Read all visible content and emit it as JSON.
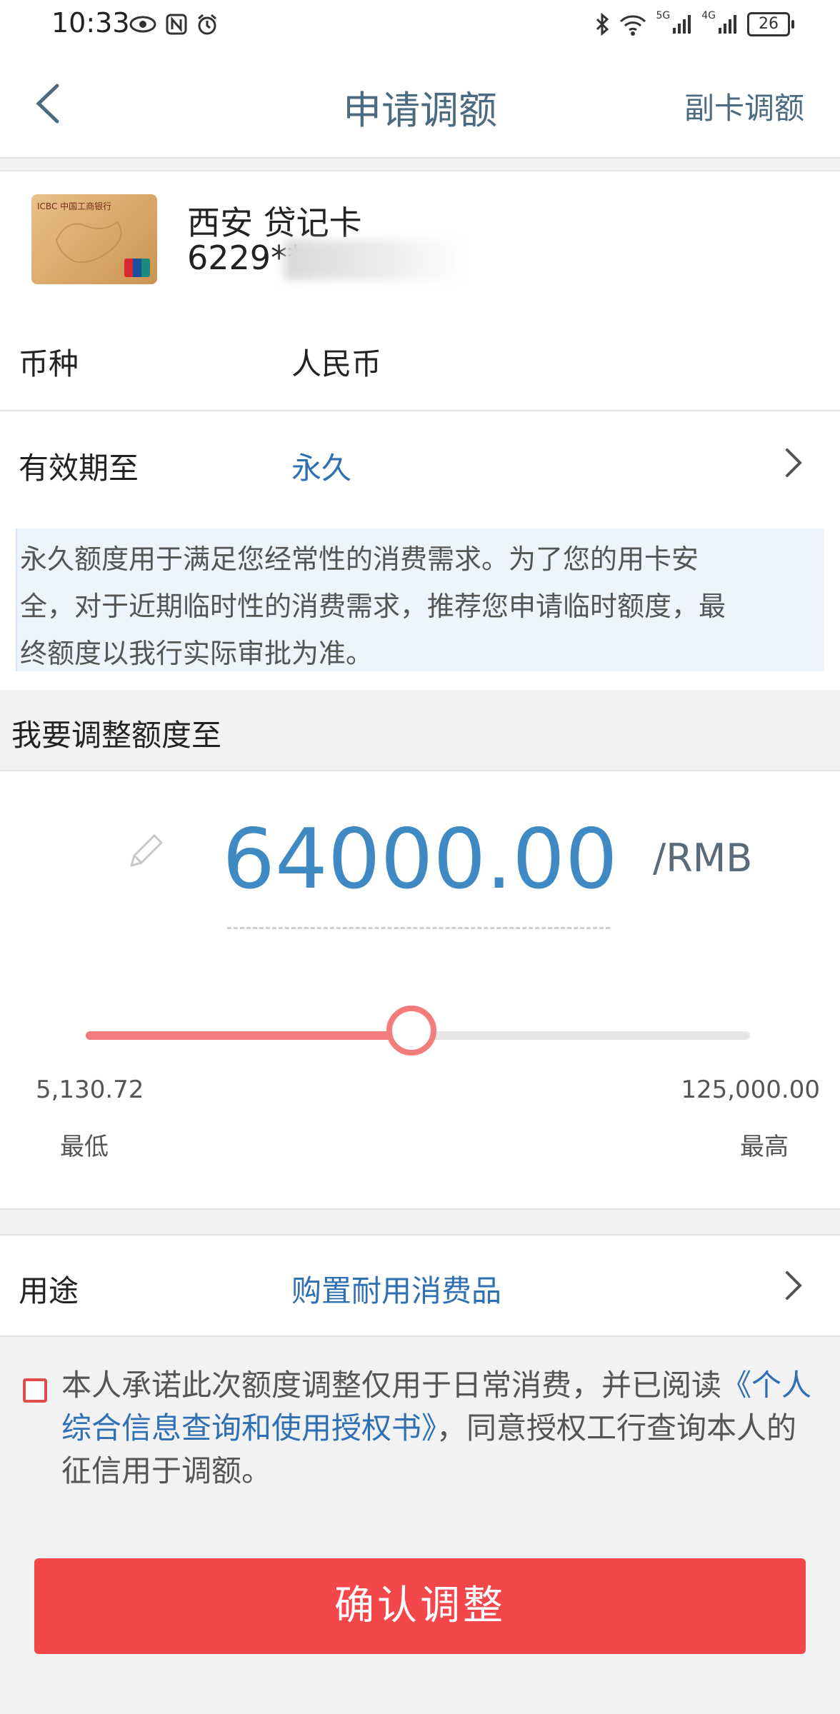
{
  "status_bar": {
    "time": "10:33",
    "battery": "26",
    "net_5g": "5G",
    "net_4g": "4G"
  },
  "nav": {
    "title": "申请调额",
    "right_action": "副卡调额"
  },
  "card": {
    "name": "西安  贷记卡",
    "number_prefix": "6229**",
    "bank_mark": "ICBC 中国工商银行"
  },
  "rows": {
    "currency_label": "币种",
    "currency_value": "人民币",
    "validity_label": "有效期至",
    "validity_value": "永久"
  },
  "notice": "永久额度用于满足您经常性的消费需求。为了您的用卡安全，对于近期临时性的消费需求，推荐您申请临时额度，最终额度以我行实际审批为准。",
  "adjust": {
    "section_title": "我要调整额度至",
    "amount": "64000.00",
    "unit": "/RMB",
    "min_value": "5,130.72",
    "max_value": "125,000.00",
    "min_label": "最低",
    "max_label": "最高",
    "slider_fraction": 0.49
  },
  "purpose": {
    "label": "用途",
    "value": "购置耐用消费品"
  },
  "agreement": {
    "text_before": "本人承诺此次额度调整仅用于日常消费，并已阅读",
    "link": "《个人综合信息查询和使用授权书》",
    "text_after": "，同意授权工行查询本人的征信用于调额。",
    "checked": false
  },
  "confirm_button": "确认调整",
  "colors": {
    "accent_blue": "#3f8ac3",
    "link_blue": "#2f6fb3",
    "slider_red": "#f27c7c",
    "button_red": "#f4474c"
  }
}
